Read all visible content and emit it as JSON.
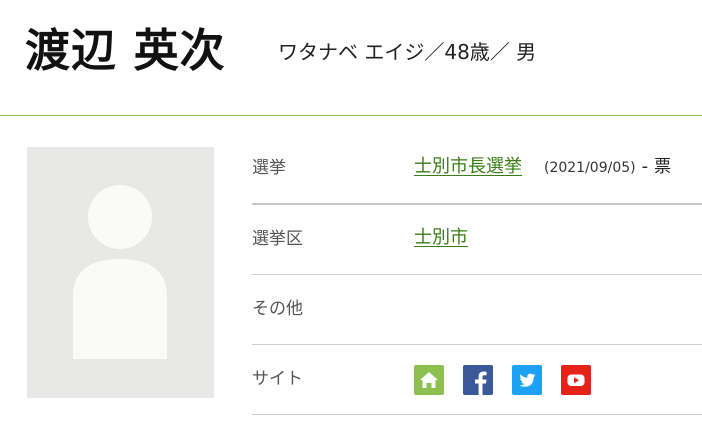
{
  "header": {
    "name": "渡辺 英次",
    "meta": "ワタナベ エイジ／48歳／ 男"
  },
  "rows": {
    "election": {
      "label": "選挙",
      "link": "士別市長選挙",
      "date": "(2021/09/05)",
      "dash": "-",
      "vote": "票"
    },
    "district": {
      "label": "選挙区",
      "link": "士別市"
    },
    "other": {
      "label": "その他",
      "value": ""
    },
    "site": {
      "label": "サイト",
      "icons": [
        "home-icon",
        "facebook-icon",
        "twitter-icon",
        "youtube-icon"
      ]
    }
  },
  "colors": {
    "accent_green": "#3a7d16",
    "home": "#8cc152",
    "facebook": "#3b5998",
    "twitter": "#1da1f2",
    "youtube": "#e62117",
    "photo_bg": "#e8e8e6"
  }
}
